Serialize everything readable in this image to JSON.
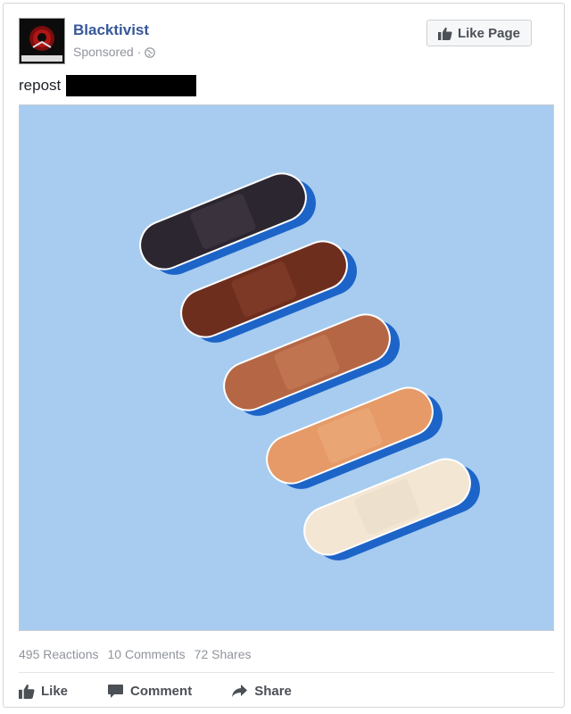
{
  "post": {
    "page_name": "Blacktivist",
    "avatar_text": "BLACKTIVIST",
    "sponsored": "Sponsored",
    "separator": "·",
    "like_page_label": "Like Page",
    "text": "repost"
  },
  "stats": {
    "reactions": "495 Reactions",
    "comments": "10 Comments",
    "shares": "72 Shares"
  },
  "actions": {
    "like": "Like",
    "comment": "Comment",
    "share": "Share"
  },
  "image": {
    "description_colors": {
      "background": "#a7ccf0",
      "bandages": [
        "#2c2630",
        "#6e2e1e",
        "#b56745",
        "#e59a67",
        "#f3e6d3"
      ]
    }
  }
}
